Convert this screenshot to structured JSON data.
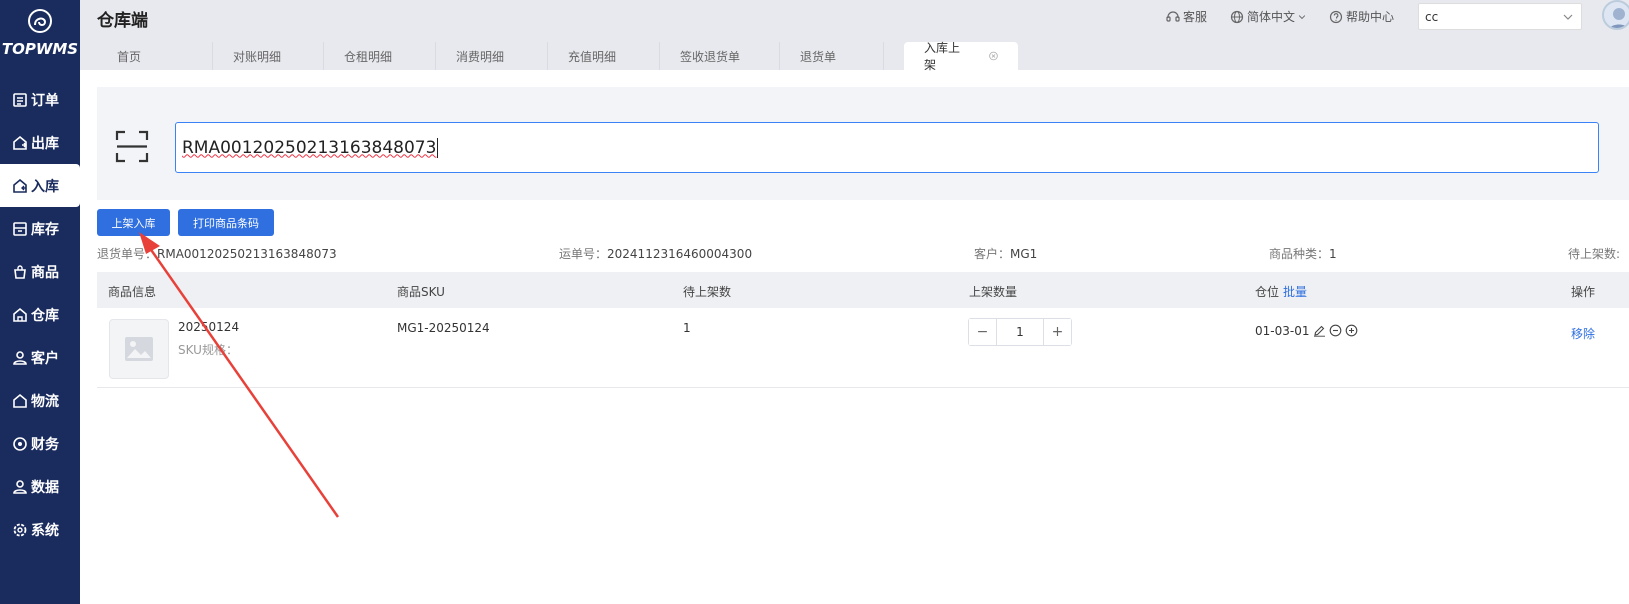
{
  "app": {
    "logo_text": "TOPWMS",
    "title": "仓库端"
  },
  "sidebar": {
    "items": [
      {
        "label": "订单",
        "icon": "order-icon",
        "active": false
      },
      {
        "label": "出库",
        "icon": "outbound-icon",
        "active": false
      },
      {
        "label": "入库",
        "icon": "inbound-icon",
        "active": true
      },
      {
        "label": "库存",
        "icon": "inventory-icon",
        "active": false
      },
      {
        "label": "商品",
        "icon": "goods-icon",
        "active": false
      },
      {
        "label": "仓库",
        "icon": "warehouse-icon",
        "active": false
      },
      {
        "label": "客户",
        "icon": "customer-icon",
        "active": false
      },
      {
        "label": "物流",
        "icon": "logistics-icon",
        "active": false
      },
      {
        "label": "财务",
        "icon": "finance-icon",
        "active": false
      },
      {
        "label": "数据",
        "icon": "data-icon",
        "active": false
      },
      {
        "label": "系统",
        "icon": "settings-icon",
        "active": false
      }
    ]
  },
  "header": {
    "service": "客服",
    "language": "简体中文",
    "help": "帮助中心",
    "account_select": "cc"
  },
  "tabs": [
    {
      "label": "首页"
    },
    {
      "label": "对账明细"
    },
    {
      "label": "仓租明细"
    },
    {
      "label": "消费明细"
    },
    {
      "label": "充值明细"
    },
    {
      "label": "签收退货单"
    },
    {
      "label": "退货单"
    },
    {
      "label": "入库上架",
      "active": true
    }
  ],
  "scan": {
    "value": "RMA00120250213163848073"
  },
  "actions": {
    "putaway": "上架入库",
    "print_barcode": "打印商品条码"
  },
  "info": {
    "return_no_label": "退货单号：",
    "return_no": "RMA00120250213163848073",
    "waybill_label": "运单号：",
    "waybill": "2024112316460004300",
    "customer_label": "客户：",
    "customer": "MG1",
    "types_label": "商品种类：",
    "types": "1",
    "pending_label": "待上架数:"
  },
  "table": {
    "headers": {
      "info": "商品信息",
      "sku": "商品SKU",
      "pending": "待上架数",
      "qty": "上架数量",
      "location": "仓位",
      "batch": "批量",
      "ops": "操作"
    },
    "rows": [
      {
        "name": "20250124",
        "spec": "SKU规格：",
        "sku": "MG1-20250124",
        "pending": "1",
        "qty": "1",
        "location": "01-03-01",
        "remove": "移除"
      }
    ]
  },
  "colors": {
    "sidebar_bg": "#1a2b5e",
    "primary": "#2f6fe0",
    "annotation_arrow": "#e8413a"
  }
}
